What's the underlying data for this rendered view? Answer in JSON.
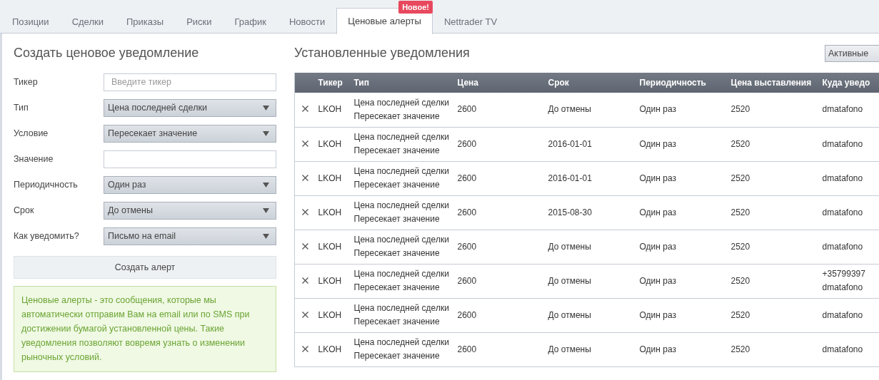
{
  "tabs": [
    {
      "label": "Позиции",
      "selected": false
    },
    {
      "label": "Сделки",
      "selected": false
    },
    {
      "label": "Приказы",
      "selected": false
    },
    {
      "label": "Риски",
      "selected": false
    },
    {
      "label": "График",
      "selected": false
    },
    {
      "label": "Новости",
      "selected": false
    },
    {
      "label": "Ценовые алерты",
      "selected": true,
      "badge": "Новое!"
    },
    {
      "label": "Nettrader TV",
      "selected": false
    }
  ],
  "create_form": {
    "title": "Создать ценовое уведомление",
    "fields": [
      {
        "label": "Тикер",
        "kind": "text",
        "placeholder": "Введите тикер"
      },
      {
        "label": "Тип",
        "kind": "select",
        "value": "Цена последней сделки"
      },
      {
        "label": "Условие",
        "kind": "select",
        "value": "Пересекает значение"
      },
      {
        "label": "Значение",
        "kind": "text"
      },
      {
        "label": "Периодичность",
        "kind": "select",
        "value": "Один раз"
      },
      {
        "label": "Срок",
        "kind": "select",
        "value": "До отмены"
      },
      {
        "label": "Как уведомить?",
        "kind": "select",
        "value": "Письмо на email"
      }
    ],
    "button": "Создать алерт",
    "info": "Ценовые алерты - это сообщения, которые мы автоматически отправим Вам на email или по SMS при достижении бумагой установленной цены. Такие уведомления позволяют вовремя узнать о изменении рыночных условий."
  },
  "alerts": {
    "title": "Установленные уведомления",
    "filter": "Активные",
    "columns": [
      "Тикер",
      "Тип",
      "Цена",
      "Срок",
      "Периодичность",
      "Цена выставления",
      "Куда уведо"
    ],
    "rows": [
      {
        "ticker": "LKOH",
        "type": [
          "Цена последней сделки",
          "Пересекает значение"
        ],
        "price": "2600",
        "term": "До отмены",
        "periodicity": "Один раз",
        "set_price": "2520",
        "destination": [
          "dmatafono"
        ]
      },
      {
        "ticker": "LKOH",
        "type": [
          "Цена последней сделки",
          "Пересекает значение"
        ],
        "price": "2600",
        "term": "2016-01-01",
        "periodicity": "Один раз",
        "set_price": "2520",
        "destination": [
          "dmatafono"
        ]
      },
      {
        "ticker": "LKOH",
        "type": [
          "Цена последней сделки",
          "Пересекает значение"
        ],
        "price": "2600",
        "term": "2016-01-01",
        "periodicity": "Один раз",
        "set_price": "2520",
        "destination": [
          "dmatafono"
        ]
      },
      {
        "ticker": "LKOH",
        "type": [
          "Цена последней сделки",
          "Пересекает значение"
        ],
        "price": "2600",
        "term": "2015-08-30",
        "periodicity": "Один раз",
        "set_price": "2520",
        "destination": [
          "dmatafono"
        ]
      },
      {
        "ticker": "LKOH",
        "type": [
          "Цена последней сделки",
          "Пересекает значение"
        ],
        "price": "2600",
        "term": "До отмены",
        "periodicity": "Один раз",
        "set_price": "2520",
        "destination": [
          "dmatafono"
        ]
      },
      {
        "ticker": "LKOH",
        "type": [
          "Цена последней сделки",
          "Пересекает значение"
        ],
        "price": "2600",
        "term": "До отмены",
        "periodicity": "Один раз",
        "set_price": "2520",
        "destination": [
          "+35799397",
          "dmatafono"
        ]
      },
      {
        "ticker": "LKOH",
        "type": [
          "Цена последней сделки",
          "Пересекает значение"
        ],
        "price": "2600",
        "term": "До отмены",
        "periodicity": "Один раз",
        "set_price": "2520",
        "destination": [
          "dmatafono"
        ]
      },
      {
        "ticker": "LKOH",
        "type": [
          "Цена последней сделки",
          "Пересекает значение"
        ],
        "price": "2600",
        "term": "До отмены",
        "periodicity": "Один раз",
        "set_price": "2520",
        "destination": [
          "dmatafono"
        ]
      }
    ]
  }
}
